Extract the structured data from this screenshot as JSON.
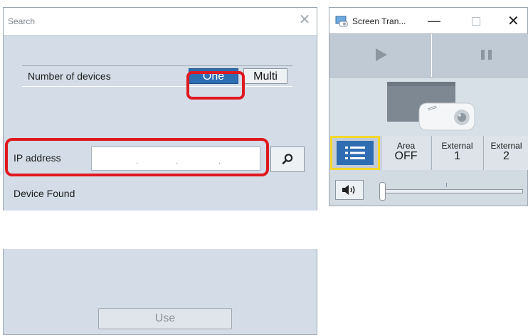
{
  "search_dialog": {
    "title": "Search",
    "close_glyph": "✕",
    "devices_label": "Number of devices",
    "option_one": "One",
    "option_multi": "Multi",
    "selected_option": "One",
    "ip_label": "IP address",
    "ip_dot": ".",
    "device_found_label": "Device Found",
    "use_button": "Use"
  },
  "screen_transfer": {
    "title": "Screen Tran...",
    "minimize_glyph": "—",
    "close_glyph": "✕",
    "area_label": "Area",
    "area_value": "OFF",
    "external1_label": "External",
    "external1_value": "1",
    "external2_label": "External",
    "external2_value": "2"
  },
  "icons": {
    "search": "search-icon",
    "play": "play-icon",
    "pause": "pause-icon",
    "menu": "list-icon",
    "speaker": "speaker-icon",
    "projector": "projector-icon",
    "app": "screen-transfer-app-icon"
  },
  "colors": {
    "highlight": "#e0191f",
    "accent": "#2f6db3",
    "focus": "#f2d72a"
  }
}
